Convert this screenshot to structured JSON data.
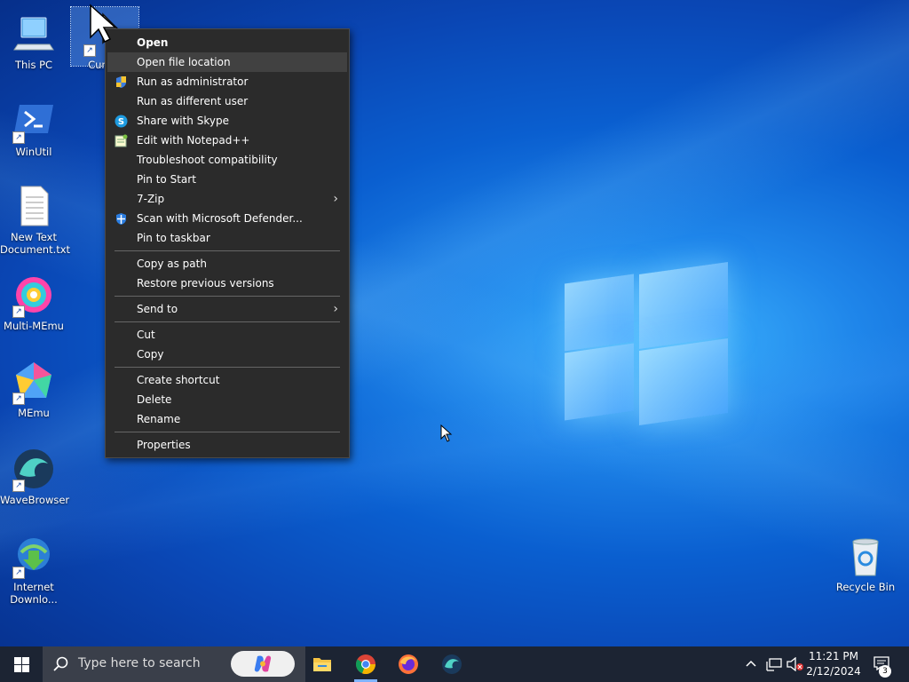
{
  "desktop": {
    "icons": [
      {
        "label": "This PC"
      },
      {
        "label": "Cursor"
      },
      {
        "label": "WinUtil"
      },
      {
        "label": "New Text Document.txt"
      },
      {
        "label": "Multi-MEmu"
      },
      {
        "label": "MEmu"
      },
      {
        "label": "WaveBrowser"
      },
      {
        "label": "Internet Downlo..."
      },
      {
        "label": "Recycle Bin"
      }
    ]
  },
  "context_menu": {
    "items": [
      {
        "label": "Open"
      },
      {
        "label": "Open file location"
      },
      {
        "label": "Run as administrator"
      },
      {
        "label": "Run as different user"
      },
      {
        "label": "Share with Skype"
      },
      {
        "label": "Edit with Notepad++"
      },
      {
        "label": "Troubleshoot compatibility"
      },
      {
        "label": "Pin to Start"
      },
      {
        "label": "7-Zip"
      },
      {
        "label": "Scan with Microsoft Defender..."
      },
      {
        "label": "Pin to taskbar"
      },
      {
        "label": "Copy as path"
      },
      {
        "label": "Restore previous versions"
      },
      {
        "label": "Send to"
      },
      {
        "label": "Cut"
      },
      {
        "label": "Copy"
      },
      {
        "label": "Create shortcut"
      },
      {
        "label": "Delete"
      },
      {
        "label": "Rename"
      },
      {
        "label": "Properties"
      }
    ]
  },
  "taskbar": {
    "search_placeholder": "Type here to search",
    "apps": [
      "File Explorer",
      "Google Chrome",
      "Firefox",
      "WaveBrowser"
    ],
    "time": "11:21 PM",
    "date": "2/12/2024",
    "notification_count": "3"
  },
  "colors": {
    "menu_bg": "#2b2b2b",
    "menu_highlight": "#414141",
    "taskbar_bg": "#1c2433",
    "accent": "#7fb3ff"
  }
}
